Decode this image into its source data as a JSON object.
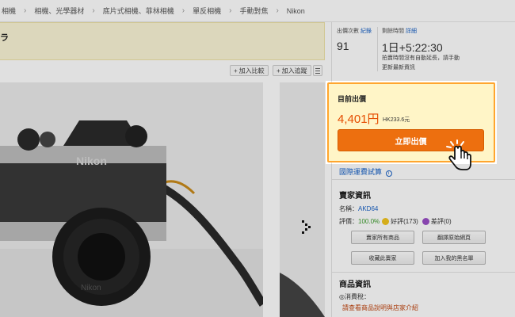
{
  "breadcrumb": [
    "相機",
    "相機、光學器材",
    "底片式相機、菲林相機",
    "單反相機",
    "手動對焦",
    "Nikon"
  ],
  "notice": {
    "text": "ラ"
  },
  "toolbar": {
    "compare_label": "加入比較",
    "watch_label": "加入追蹤"
  },
  "stats": {
    "bid_count_label": "出價次數",
    "bid_history_link": "紀錄",
    "bid_count": "91",
    "time_left_label": "剩餘時間",
    "time_detail_link": "詳細",
    "time_left": "1日+5:22:30",
    "time_note": "拍賣時間沒有自動延長，請手動更新最新資訊"
  },
  "bid": {
    "title": "目前出價",
    "price": "4,401円",
    "price_hkd": "HK233.6元",
    "button_label": "立即出價"
  },
  "shipping_link": "國際運費試算",
  "seller": {
    "title": "賣家資訊",
    "name_label": "名稱：",
    "name": "AKD64",
    "rating_label": "評價：",
    "rating_percent": "100.0%",
    "good_label": "好評(173)",
    "bad_label": "差評(0)",
    "buttons": [
      "賣家所有商品",
      "翻譯原始網頁",
      "收藏此賣家",
      "加入我的黑名單"
    ]
  },
  "item_info": {
    "title": "商品資訊",
    "tax_label": "◎消費稅：",
    "read_note": "請查看商品說明與店家介紹"
  },
  "colors": {
    "accent": "#ed6f0f",
    "bid_box_bg": "#fff5c7",
    "bid_border": "#ffa52e",
    "link": "#1a62c6",
    "price": "#e54c00"
  },
  "icons": {
    "next": "chevron-right-icon",
    "cursor": "hand-pointer-icon",
    "info": "info-circle-icon",
    "menu": "menu-icon"
  }
}
